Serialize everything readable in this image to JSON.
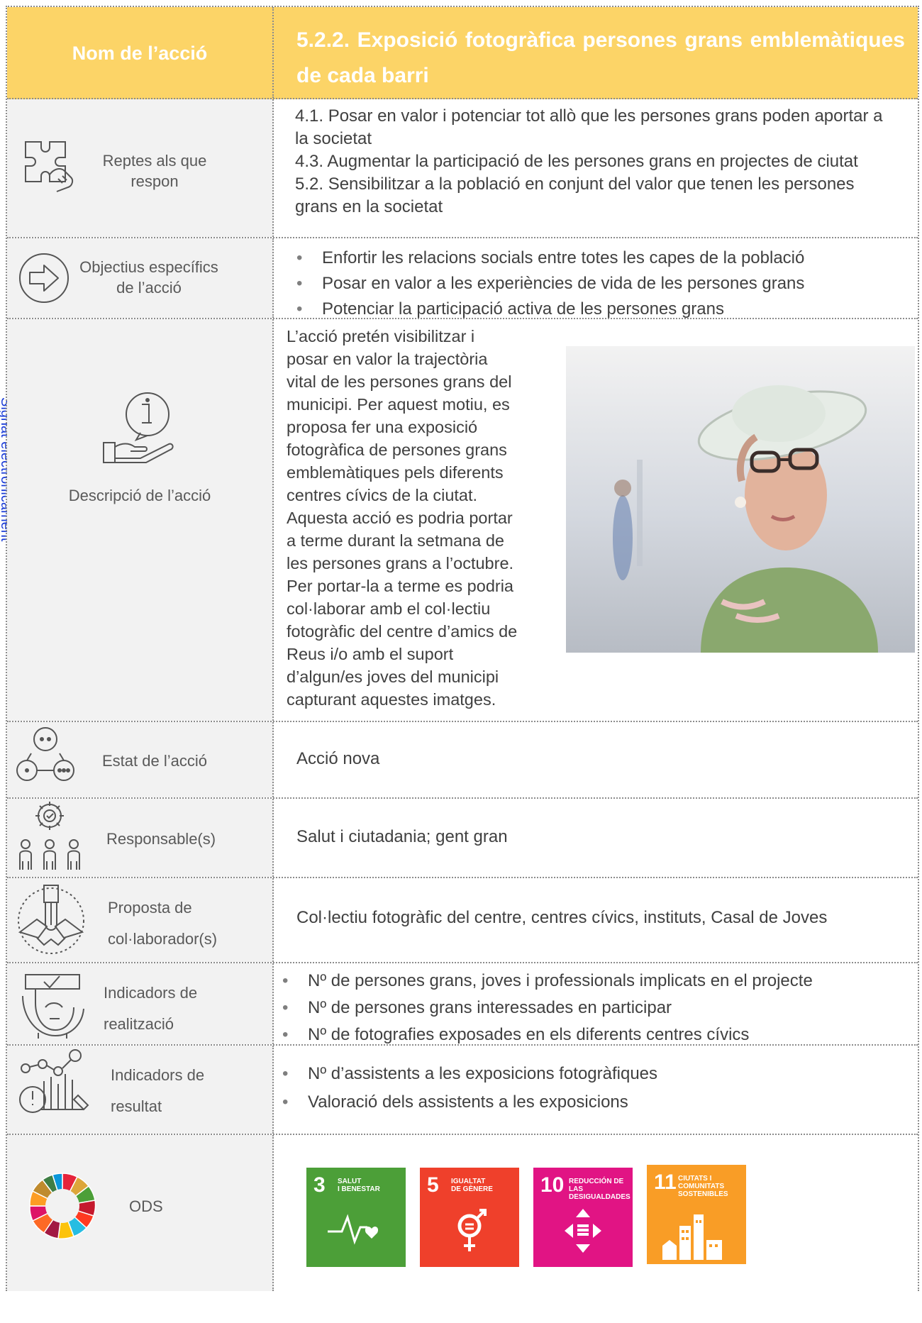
{
  "side_stamp": "Signat electrònicament",
  "header": {
    "label": "Nom de l’acció",
    "title": "5.2.2. Exposició fotogràfica persones grans emblemàtiques de cada barri"
  },
  "rows": {
    "reptes": {
      "label_line1": "Reptes als que",
      "label_line2": "respon",
      "icon": "puzzle-icon",
      "text": [
        "4.1. Posar en valor i potenciar tot allò que les persones grans poden aportar a la societat",
        "4.3. Augmentar la participació de les persones grans en projectes de ciutat",
        "5.2. Sensibilitzar a la població en conjunt del valor que tenen les persones grans en la societat"
      ]
    },
    "objectius": {
      "label_line1": "Objectius específics",
      "label_line2": "de l’acció",
      "icon": "arrow-right-circle-icon",
      "items": [
        "Enfortir les relacions socials entre totes les capes de la població",
        "Posar en valor a les experiències de vida de les persones grans",
        "Potenciar la participació activa de les persones grans"
      ]
    },
    "descripcio": {
      "label": "Descripció de l’acció",
      "icon": "info-hand-icon",
      "text": "L’acció pretén visibilitzar i posar en valor la trajectòria vital de les persones grans del municipi. Per aquest motiu, es proposa fer una exposició fotogràfica de persones grans emblemàtiques pels diferents centres cívics de la ciutat. Aquesta acció es podria portar a terme durant la setmana de les persones grans a l’octubre. Per portar-la a terme es podria col·laborar amb el col·lectiu fotogràfic del centre d’amics de Reus i/o amb el suport d’algun/es joves del municipi capturant aquestes imatges."
    },
    "estat": {
      "label": "Estat de l’acció",
      "icon": "status-circles-icon",
      "value": "Acció nova"
    },
    "responsable": {
      "label": "Responsable(s)",
      "icon": "people-gear-icon",
      "value": "Salut i ciutadania; gent gran"
    },
    "proposta": {
      "label_line1": "Proposta de",
      "label_line2": "col·laborador(s)",
      "icon": "hands-together-icon",
      "value": "Col·lectiu fotogràfic del centre, centres cívics, instituts, Casal de Joves"
    },
    "indicadors_realitzacio": {
      "label_line1": "Indicadors de",
      "label_line2": "realització",
      "icon": "head-check-icon",
      "items": [
        "Nº de persones grans, joves i professionals implicats en el projecte",
        "Nº de persones grans interessades en participar",
        "Nº de fotografies exposades en els diferents centres cívics"
      ]
    },
    "indicadors_resultat": {
      "label_line1": "Indicadors de",
      "label_line2": "resultat",
      "icon": "chart-gauge-icon",
      "items": [
        "Nº d’assistents a les exposicions fotogràfiques",
        "Valoració dels assistents a les exposicions"
      ]
    },
    "ods": {
      "label": "ODS",
      "icon": "sdg-wheel-icon",
      "goals": [
        {
          "number": "3",
          "line1": "SALUT",
          "line2": "I BENESTAR",
          "color": "#4c9f38"
        },
        {
          "number": "5",
          "line1": "IGUALTAT",
          "line2": "DE GÈNERE",
          "color": "#ef402b"
        },
        {
          "number": "10",
          "line1": "REDUCCIÓN DE LAS",
          "line2": "DESIGUALDADES",
          "color": "#e11484"
        },
        {
          "number": "11",
          "line1": "CIUTATS I",
          "line2": "COMUNITATS SOSTENIBLES",
          "color": "#f99d26"
        }
      ]
    }
  }
}
